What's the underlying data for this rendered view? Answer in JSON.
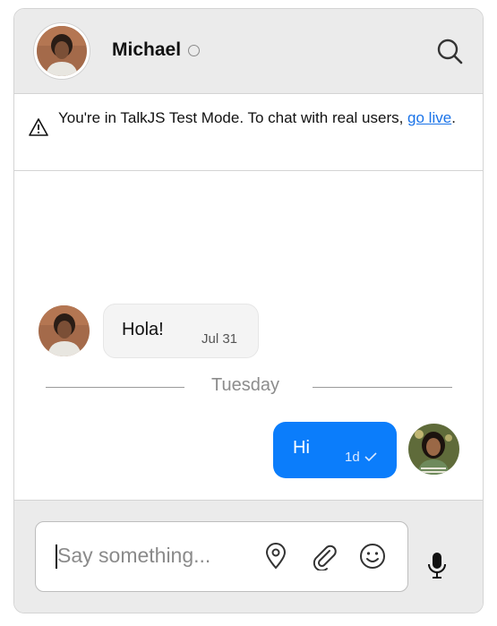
{
  "header": {
    "name": "Michael",
    "status": "offline"
  },
  "notice": {
    "text": "You're in TalkJS Test Mode. To chat with real users, ",
    "link": "go live",
    "suffix": "."
  },
  "messages": [
    {
      "direction": "incoming",
      "text": "Hola!",
      "time": "Jul 31"
    },
    {
      "direction": "outgoing",
      "text": "Hi",
      "time": "1d",
      "read": true
    }
  ],
  "day_separator": "Tuesday",
  "composer": {
    "placeholder": "Say something..."
  },
  "icons": {
    "search": "search-icon",
    "warning": "warning-icon",
    "location": "location-pin-icon",
    "attach": "paperclip-icon",
    "emoji": "emoji-icon",
    "mic": "microphone-icon",
    "check": "check-icon"
  },
  "colors": {
    "accent": "#0b7dfb",
    "header_bg": "#ebebeb",
    "link": "#1a73e8"
  }
}
